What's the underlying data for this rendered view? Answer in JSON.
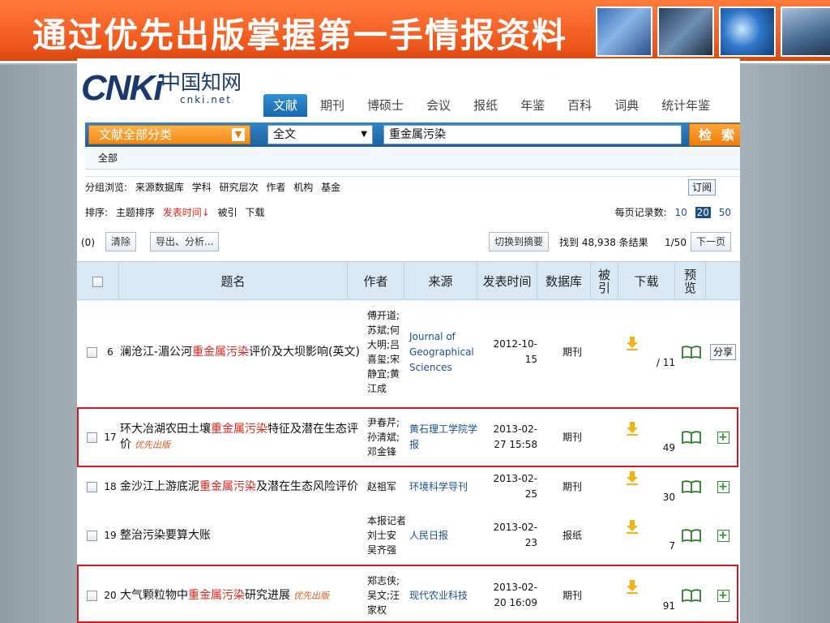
{
  "slide": {
    "title": "通过优先出版掌握第一手情报资料"
  },
  "logo": {
    "mark": "CNKi",
    "cn": "中国知网",
    "net": "cnki.net"
  },
  "nav": {
    "tabs": [
      {
        "label": "文献",
        "active": true
      },
      {
        "label": "期刊"
      },
      {
        "label": "博硕士"
      },
      {
        "label": "会议"
      },
      {
        "label": "报纸"
      },
      {
        "label": "年鉴"
      },
      {
        "label": "百科"
      },
      {
        "label": "词典"
      },
      {
        "label": "统计年鉴"
      }
    ]
  },
  "search": {
    "category": "文献全部分类",
    "field": "全文",
    "query": "重金属污染",
    "button": "检索"
  },
  "filter": {
    "all": "全部",
    "group_label": "分组浏览:",
    "groups": [
      "来源数据库",
      "学科",
      "研究层次",
      "作者",
      "机构",
      "基金"
    ],
    "subscribe": "订阅",
    "sort_label": "排序:",
    "sort_options": [
      "主题排序",
      "发表时间↓",
      "被引",
      "下载"
    ],
    "per_page_label": "每页记录数:",
    "per_page_options": [
      "10",
      "20",
      "50"
    ],
    "per_page_selected": "20"
  },
  "actions": {
    "selected_count": "(0)",
    "clear": "清除",
    "export": "导出、分析...",
    "switch": "切换到摘要",
    "found_prefix": "找到",
    "found_count": "48,938",
    "found_suffix": "条结果",
    "page": "1/50",
    "next": "下一页"
  },
  "table": {
    "headers": {
      "title": "题名",
      "author": "作者",
      "source": "来源",
      "date": "发表时间",
      "db": "数据库",
      "cited": "被引",
      "download": "下载",
      "preview": "预览"
    },
    "rows": [
      {
        "num": "6",
        "title_pre": "澜沧江-湄公河",
        "title_hl": "重金属污染",
        "title_post": "评价及大坝影响(英文)",
        "tag": "",
        "author": "傅开道;苏斌;何大明;吕喜玺;宋静宜;黄江成",
        "source": "Journal of Geographical Sciences",
        "date": "2012-10-15",
        "db": "期刊",
        "downloads": "/ 11",
        "extra": "分享"
      },
      {
        "num": "17",
        "title_pre": "环大冶湖农田土壤",
        "title_hl": "重金属污染",
        "title_post": "特征及潜在生态评价",
        "tag": "优先出版",
        "author": "尹春芹;孙清斌;邓金锋",
        "source": "黄石理工学院学报",
        "date": "2013-02-27 15:58",
        "db": "期刊",
        "downloads": "49",
        "extra": "+"
      },
      {
        "num": "18",
        "title_pre": "金沙江上游底泥",
        "title_hl": "重金属污染",
        "title_post": "及潜在生态风险评价",
        "tag": "",
        "author": "赵祖军",
        "source": "环境科学导刊",
        "date": "2013-02-25",
        "db": "期刊",
        "downloads": "30",
        "extra": "+"
      },
      {
        "num": "19",
        "title_pre": "整治污染要算大账",
        "title_hl": "",
        "title_post": "",
        "tag": "",
        "author": "本报记者 刘士安 吴齐强",
        "source": "人民日报",
        "date": "2013-02-23",
        "db": "报纸",
        "downloads": "7",
        "extra": "+"
      },
      {
        "num": "20",
        "title_pre": "大气颗粒物中",
        "title_hl": "重金属污染",
        "title_post": "研究进展",
        "tag": "优先出版",
        "author": "郑志侠;吴文;汪家权",
        "source": "现代农业科技",
        "date": "2013-02-20 16:09",
        "db": "期刊",
        "downloads": "91",
        "extra": "+"
      }
    ]
  },
  "colors": {
    "title_bar": "#f05a1e",
    "highlight": "#e0261d",
    "box": "#d9161c",
    "link": "#1b4f8c"
  }
}
